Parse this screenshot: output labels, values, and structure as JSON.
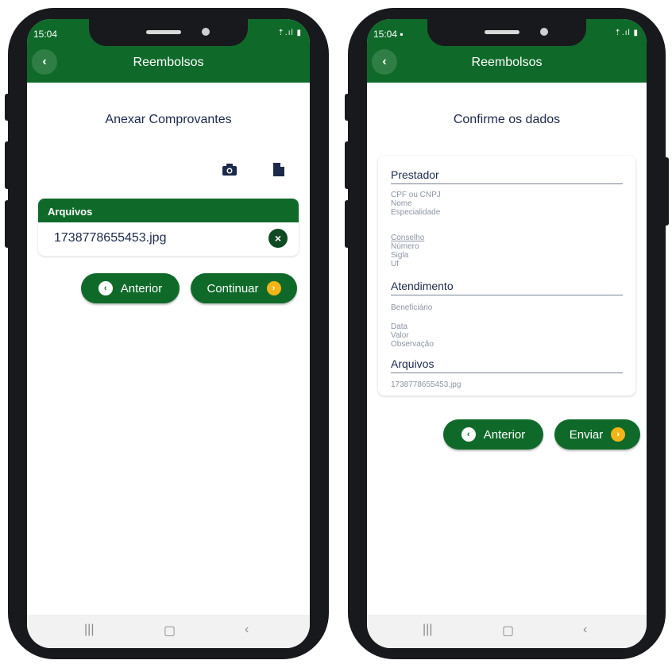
{
  "left": {
    "status_time": "15:04",
    "status_icons": "⇡.ıl ▮",
    "appbar_title": "Reembolsos",
    "page_title": "Anexar Comprovantes",
    "files_header": "Arquivos",
    "file_name": "1738778655453.jpg",
    "btn_prev": "Anterior",
    "btn_next": "Continuar"
  },
  "right": {
    "status_time": "15:04 ▪",
    "status_icons": "⇡.ıl ▮",
    "appbar_title": "Reembolsos",
    "page_title": "Confirme os dados",
    "sec_prestador": "Prestador",
    "f_cpf": "CPF ou CNPJ",
    "f_nome": "Nome",
    "f_especialidade": "Especialidade",
    "f_conselho": "Conselho",
    "f_numero": "Número",
    "f_sigla": "Sigla",
    "f_uf": "Uf",
    "sec_atendimento": "Atendimento",
    "f_beneficiario": "Beneficiário",
    "f_data": "Data",
    "f_valor": "Valor",
    "f_observacao": "Observação",
    "sec_arquivos": "Arquivos",
    "f_file": "1738778655453.jpg",
    "btn_prev": "Anterior",
    "btn_send": "Enviar"
  },
  "colors": {
    "primary": "#0f6a2a",
    "accent": "#f2b417",
    "text": "#1c2a4a"
  }
}
